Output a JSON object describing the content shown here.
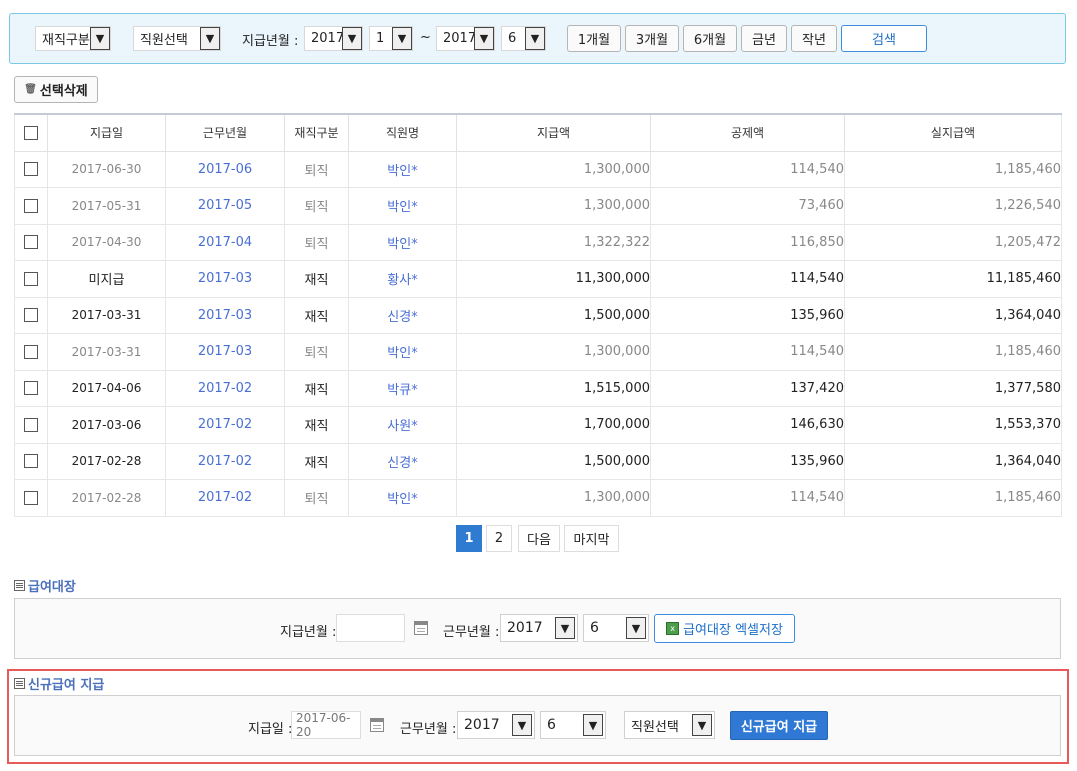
{
  "filter": {
    "status_select": "재직구분",
    "employee_select": "직원선택",
    "pay_period_label": "지급년월 :",
    "from_year": "2017",
    "from_month": "1",
    "tilde": "~",
    "to_year": "2017",
    "to_month": "6",
    "buttons": {
      "m1": "1개월",
      "m3": "3개월",
      "m6": "6개월",
      "this_year": "금년",
      "last_year": "작년"
    },
    "search": "검색"
  },
  "delete_button": "선택삭제",
  "table": {
    "headers": [
      "지급일",
      "근무년월",
      "재직구분",
      "직원명",
      "지급액",
      "공제액",
      "실지급액"
    ],
    "rows": [
      {
        "pay_date": "2017-06-30",
        "work_month": "2017-06",
        "status": "퇴직",
        "name": "박인*",
        "amount": "1,300,000",
        "deduction": "114,540",
        "net": "1,185,460",
        "retired": true
      },
      {
        "pay_date": "2017-05-31",
        "work_month": "2017-05",
        "status": "퇴직",
        "name": "박인*",
        "amount": "1,300,000",
        "deduction": "73,460",
        "net": "1,226,540",
        "retired": true
      },
      {
        "pay_date": "2017-04-30",
        "work_month": "2017-04",
        "status": "퇴직",
        "name": "박인*",
        "amount": "1,322,322",
        "deduction": "116,850",
        "net": "1,205,472",
        "retired": true
      },
      {
        "pay_date": "미지급",
        "work_month": "2017-03",
        "status": "재직",
        "name": "황사*",
        "amount": "11,300,000",
        "deduction": "114,540",
        "net": "11,185,460",
        "retired": false
      },
      {
        "pay_date": "2017-03-31",
        "work_month": "2017-03",
        "status": "재직",
        "name": "신경*",
        "amount": "1,500,000",
        "deduction": "135,960",
        "net": "1,364,040",
        "retired": false
      },
      {
        "pay_date": "2017-03-31",
        "work_month": "2017-03",
        "status": "퇴직",
        "name": "박인*",
        "amount": "1,300,000",
        "deduction": "114,540",
        "net": "1,185,460",
        "retired": true
      },
      {
        "pay_date": "2017-04-06",
        "work_month": "2017-02",
        "status": "재직",
        "name": "박큐*",
        "amount": "1,515,000",
        "deduction": "137,420",
        "net": "1,377,580",
        "retired": false
      },
      {
        "pay_date": "2017-03-06",
        "work_month": "2017-02",
        "status": "재직",
        "name": "사원*",
        "amount": "1,700,000",
        "deduction": "146,630",
        "net": "1,553,370",
        "retired": false
      },
      {
        "pay_date": "2017-02-28",
        "work_month": "2017-02",
        "status": "재직",
        "name": "신경*",
        "amount": "1,500,000",
        "deduction": "135,960",
        "net": "1,364,040",
        "retired": false
      },
      {
        "pay_date": "2017-02-28",
        "work_month": "2017-02",
        "status": "퇴직",
        "name": "박인*",
        "amount": "1,300,000",
        "deduction": "114,540",
        "net": "1,185,460",
        "retired": true
      }
    ]
  },
  "pagination": {
    "pages": [
      "1",
      "2"
    ],
    "current": "1",
    "next": "다음",
    "last": "마지막"
  },
  "ledger": {
    "title": "급여대장",
    "pay_month_label": "지급년월 :",
    "pay_month_value": "",
    "work_month_label": "근무년월 :",
    "year": "2017",
    "month": "6",
    "excel_button": "급여대장 엑셀저장"
  },
  "new_pay": {
    "title": "신규급여 지급",
    "pay_date_label": "지급일 :",
    "pay_date_value": "2017-06-20",
    "work_month_label": "근무년월 :",
    "year": "2017",
    "month": "6",
    "employee_select": "직원선택",
    "submit_button": "신규급여 지급"
  },
  "colors": {
    "accent": "#2e7bd1",
    "link": "#4a6fd4",
    "highlight": "#e85a5a",
    "filter_bg": "#eaf6fc"
  }
}
